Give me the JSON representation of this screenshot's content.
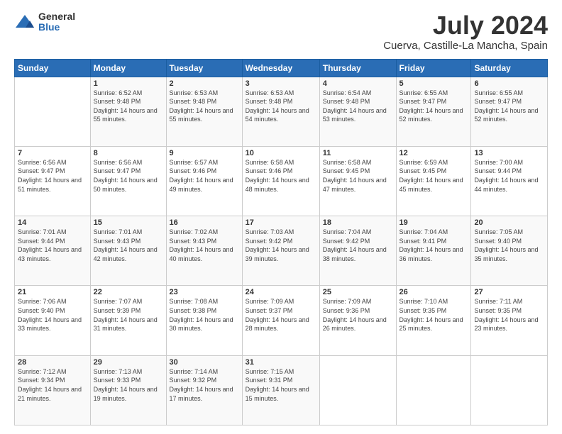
{
  "header": {
    "logo_general": "General",
    "logo_blue": "Blue",
    "title": "July 2024",
    "subtitle": "Cuerva, Castille-La Mancha, Spain"
  },
  "days_of_week": [
    "Sunday",
    "Monday",
    "Tuesday",
    "Wednesday",
    "Thursday",
    "Friday",
    "Saturday"
  ],
  "weeks": [
    [
      {
        "day": "",
        "sunrise": "",
        "sunset": "",
        "daylight": ""
      },
      {
        "day": "1",
        "sunrise": "Sunrise: 6:52 AM",
        "sunset": "Sunset: 9:48 PM",
        "daylight": "Daylight: 14 hours and 55 minutes."
      },
      {
        "day": "2",
        "sunrise": "Sunrise: 6:53 AM",
        "sunset": "Sunset: 9:48 PM",
        "daylight": "Daylight: 14 hours and 55 minutes."
      },
      {
        "day": "3",
        "sunrise": "Sunrise: 6:53 AM",
        "sunset": "Sunset: 9:48 PM",
        "daylight": "Daylight: 14 hours and 54 minutes."
      },
      {
        "day": "4",
        "sunrise": "Sunrise: 6:54 AM",
        "sunset": "Sunset: 9:48 PM",
        "daylight": "Daylight: 14 hours and 53 minutes."
      },
      {
        "day": "5",
        "sunrise": "Sunrise: 6:55 AM",
        "sunset": "Sunset: 9:47 PM",
        "daylight": "Daylight: 14 hours and 52 minutes."
      },
      {
        "day": "6",
        "sunrise": "Sunrise: 6:55 AM",
        "sunset": "Sunset: 9:47 PM",
        "daylight": "Daylight: 14 hours and 52 minutes."
      }
    ],
    [
      {
        "day": "7",
        "sunrise": "Sunrise: 6:56 AM",
        "sunset": "Sunset: 9:47 PM",
        "daylight": "Daylight: 14 hours and 51 minutes."
      },
      {
        "day": "8",
        "sunrise": "Sunrise: 6:56 AM",
        "sunset": "Sunset: 9:47 PM",
        "daylight": "Daylight: 14 hours and 50 minutes."
      },
      {
        "day": "9",
        "sunrise": "Sunrise: 6:57 AM",
        "sunset": "Sunset: 9:46 PM",
        "daylight": "Daylight: 14 hours and 49 minutes."
      },
      {
        "day": "10",
        "sunrise": "Sunrise: 6:58 AM",
        "sunset": "Sunset: 9:46 PM",
        "daylight": "Daylight: 14 hours and 48 minutes."
      },
      {
        "day": "11",
        "sunrise": "Sunrise: 6:58 AM",
        "sunset": "Sunset: 9:45 PM",
        "daylight": "Daylight: 14 hours and 47 minutes."
      },
      {
        "day": "12",
        "sunrise": "Sunrise: 6:59 AM",
        "sunset": "Sunset: 9:45 PM",
        "daylight": "Daylight: 14 hours and 45 minutes."
      },
      {
        "day": "13",
        "sunrise": "Sunrise: 7:00 AM",
        "sunset": "Sunset: 9:44 PM",
        "daylight": "Daylight: 14 hours and 44 minutes."
      }
    ],
    [
      {
        "day": "14",
        "sunrise": "Sunrise: 7:01 AM",
        "sunset": "Sunset: 9:44 PM",
        "daylight": "Daylight: 14 hours and 43 minutes."
      },
      {
        "day": "15",
        "sunrise": "Sunrise: 7:01 AM",
        "sunset": "Sunset: 9:43 PM",
        "daylight": "Daylight: 14 hours and 42 minutes."
      },
      {
        "day": "16",
        "sunrise": "Sunrise: 7:02 AM",
        "sunset": "Sunset: 9:43 PM",
        "daylight": "Daylight: 14 hours and 40 minutes."
      },
      {
        "day": "17",
        "sunrise": "Sunrise: 7:03 AM",
        "sunset": "Sunset: 9:42 PM",
        "daylight": "Daylight: 14 hours and 39 minutes."
      },
      {
        "day": "18",
        "sunrise": "Sunrise: 7:04 AM",
        "sunset": "Sunset: 9:42 PM",
        "daylight": "Daylight: 14 hours and 38 minutes."
      },
      {
        "day": "19",
        "sunrise": "Sunrise: 7:04 AM",
        "sunset": "Sunset: 9:41 PM",
        "daylight": "Daylight: 14 hours and 36 minutes."
      },
      {
        "day": "20",
        "sunrise": "Sunrise: 7:05 AM",
        "sunset": "Sunset: 9:40 PM",
        "daylight": "Daylight: 14 hours and 35 minutes."
      }
    ],
    [
      {
        "day": "21",
        "sunrise": "Sunrise: 7:06 AM",
        "sunset": "Sunset: 9:40 PM",
        "daylight": "Daylight: 14 hours and 33 minutes."
      },
      {
        "day": "22",
        "sunrise": "Sunrise: 7:07 AM",
        "sunset": "Sunset: 9:39 PM",
        "daylight": "Daylight: 14 hours and 31 minutes."
      },
      {
        "day": "23",
        "sunrise": "Sunrise: 7:08 AM",
        "sunset": "Sunset: 9:38 PM",
        "daylight": "Daylight: 14 hours and 30 minutes."
      },
      {
        "day": "24",
        "sunrise": "Sunrise: 7:09 AM",
        "sunset": "Sunset: 9:37 PM",
        "daylight": "Daylight: 14 hours and 28 minutes."
      },
      {
        "day": "25",
        "sunrise": "Sunrise: 7:09 AM",
        "sunset": "Sunset: 9:36 PM",
        "daylight": "Daylight: 14 hours and 26 minutes."
      },
      {
        "day": "26",
        "sunrise": "Sunrise: 7:10 AM",
        "sunset": "Sunset: 9:35 PM",
        "daylight": "Daylight: 14 hours and 25 minutes."
      },
      {
        "day": "27",
        "sunrise": "Sunrise: 7:11 AM",
        "sunset": "Sunset: 9:35 PM",
        "daylight": "Daylight: 14 hours and 23 minutes."
      }
    ],
    [
      {
        "day": "28",
        "sunrise": "Sunrise: 7:12 AM",
        "sunset": "Sunset: 9:34 PM",
        "daylight": "Daylight: 14 hours and 21 minutes."
      },
      {
        "day": "29",
        "sunrise": "Sunrise: 7:13 AM",
        "sunset": "Sunset: 9:33 PM",
        "daylight": "Daylight: 14 hours and 19 minutes."
      },
      {
        "day": "30",
        "sunrise": "Sunrise: 7:14 AM",
        "sunset": "Sunset: 9:32 PM",
        "daylight": "Daylight: 14 hours and 17 minutes."
      },
      {
        "day": "31",
        "sunrise": "Sunrise: 7:15 AM",
        "sunset": "Sunset: 9:31 PM",
        "daylight": "Daylight: 14 hours and 15 minutes."
      },
      {
        "day": "",
        "sunrise": "",
        "sunset": "",
        "daylight": ""
      },
      {
        "day": "",
        "sunrise": "",
        "sunset": "",
        "daylight": ""
      },
      {
        "day": "",
        "sunrise": "",
        "sunset": "",
        "daylight": ""
      }
    ]
  ]
}
